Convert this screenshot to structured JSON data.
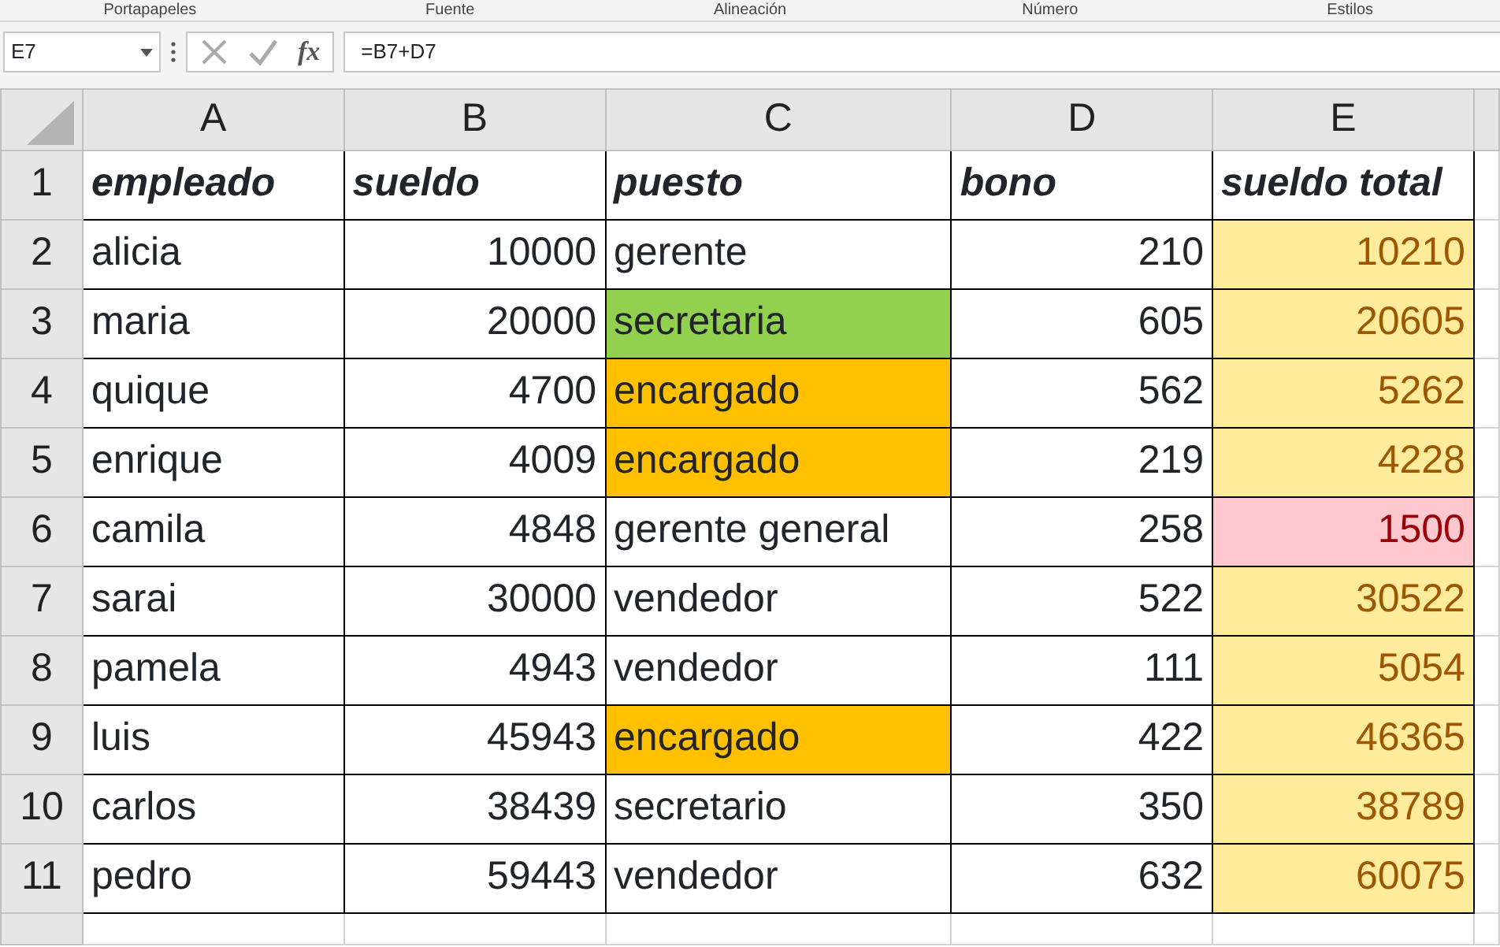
{
  "ribbon_groups": [
    "Portapapeles",
    "Fuente",
    "Alineación",
    "Número",
    "Estilos"
  ],
  "name_box": "E7",
  "function_button": "fx",
  "formula": "=B7+D7",
  "columns": [
    "A",
    "B",
    "C",
    "D",
    "E"
  ],
  "rows": [
    {
      "number": "1",
      "kind": "heading",
      "cells": [
        {
          "text": "empleado",
          "kind": "text"
        },
        {
          "text": "sueldo",
          "kind": "text"
        },
        {
          "text": "puesto",
          "kind": "text"
        },
        {
          "text": "bono",
          "kind": "text"
        },
        {
          "text": "sueldo total",
          "kind": "text"
        }
      ]
    },
    {
      "number": "2",
      "kind": "data",
      "cells": [
        {
          "text": "alicia",
          "kind": "text"
        },
        {
          "text": "10000",
          "kind": "number"
        },
        {
          "text": "gerente",
          "kind": "text"
        },
        {
          "text": "210",
          "kind": "number"
        },
        {
          "text": "10210",
          "kind": "neutral"
        }
      ]
    },
    {
      "number": "3",
      "kind": "data",
      "cells": [
        {
          "text": "maria",
          "kind": "text"
        },
        {
          "text": "20000",
          "kind": "number"
        },
        {
          "text": "secretaria",
          "kind": "text",
          "color": "#92d050"
        },
        {
          "text": "605",
          "kind": "number"
        },
        {
          "text": "20605",
          "kind": "neutral"
        }
      ]
    },
    {
      "number": "4",
      "kind": "data",
      "cells": [
        {
          "text": "quique",
          "kind": "text"
        },
        {
          "text": "4700",
          "kind": "number"
        },
        {
          "text": "encargado",
          "kind": "text",
          "color": "#ffc000"
        },
        {
          "text": "562",
          "kind": "number"
        },
        {
          "text": "5262",
          "kind": "neutral"
        }
      ]
    },
    {
      "number": "5",
      "kind": "data",
      "cells": [
        {
          "text": "enrique",
          "kind": "text"
        },
        {
          "text": "4009",
          "kind": "number"
        },
        {
          "text": "encargado",
          "kind": "text",
          "color": "#ffc000"
        },
        {
          "text": "219",
          "kind": "number"
        },
        {
          "text": "4228",
          "kind": "neutral"
        }
      ]
    },
    {
      "number": "6",
      "kind": "data",
      "cells": [
        {
          "text": "camila",
          "kind": "text"
        },
        {
          "text": "4848",
          "kind": "number"
        },
        {
          "text": "gerente general",
          "kind": "text"
        },
        {
          "text": "258",
          "kind": "number"
        },
        {
          "text": "1500",
          "kind": "bad"
        }
      ]
    },
    {
      "number": "7",
      "kind": "data",
      "cells": [
        {
          "text": "sarai",
          "kind": "text"
        },
        {
          "text": "30000",
          "kind": "number"
        },
        {
          "text": "vendedor",
          "kind": "text"
        },
        {
          "text": "522",
          "kind": "number"
        },
        {
          "text": "30522",
          "kind": "neutral"
        }
      ]
    },
    {
      "number": "8",
      "kind": "data",
      "cells": [
        {
          "text": "pamela",
          "kind": "text"
        },
        {
          "text": "4943",
          "kind": "number"
        },
        {
          "text": "vendedor",
          "kind": "text"
        },
        {
          "text": "111",
          "kind": "number"
        },
        {
          "text": "5054",
          "kind": "neutral"
        }
      ]
    },
    {
      "number": "9",
      "kind": "data",
      "cells": [
        {
          "text": "luis",
          "kind": "text"
        },
        {
          "text": "45943",
          "kind": "number"
        },
        {
          "text": "encargado",
          "kind": "text",
          "color": "#ffc000"
        },
        {
          "text": "422",
          "kind": "number"
        },
        {
          "text": "46365",
          "kind": "neutral"
        }
      ]
    },
    {
      "number": "10",
      "kind": "data",
      "cells": [
        {
          "text": "carlos",
          "kind": "text"
        },
        {
          "text": "38439",
          "kind": "number"
        },
        {
          "text": "secretario",
          "kind": "text"
        },
        {
          "text": "350",
          "kind": "number"
        },
        {
          "text": "38789",
          "kind": "neutral"
        }
      ]
    },
    {
      "number": "11",
      "kind": "data",
      "cells": [
        {
          "text": "pedro",
          "kind": "text"
        },
        {
          "text": "59443",
          "kind": "number"
        },
        {
          "text": "vendedor",
          "kind": "text"
        },
        {
          "text": "632",
          "kind": "number"
        },
        {
          "text": "60075",
          "kind": "neutral"
        }
      ]
    }
  ]
}
